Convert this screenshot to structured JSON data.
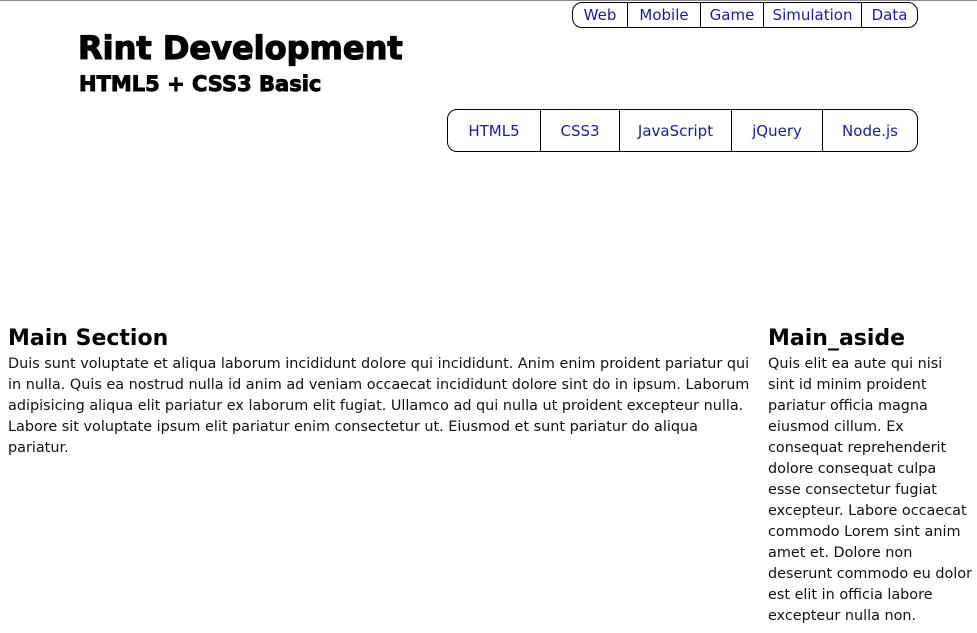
{
  "gnb": {
    "items": [
      {
        "label": "Web"
      },
      {
        "label": "Mobile"
      },
      {
        "label": "Game"
      },
      {
        "label": "Simulation"
      },
      {
        "label": "Data"
      }
    ]
  },
  "header": {
    "title": "Rint Development",
    "subtitle": "HTML5 + CSS3 Basic"
  },
  "lnb": {
    "items": [
      {
        "label": "HTML5"
      },
      {
        "label": "CSS3"
      },
      {
        "label": "JavaScript"
      },
      {
        "label": "jQuery"
      },
      {
        "label": "Node.js"
      }
    ]
  },
  "main_section": {
    "heading": "Main Section",
    "text": "Duis sunt voluptate et aliqua laborum incididunt dolore qui incididunt. Anim enim proident pariatur qui in nulla. Quis ea nostrud nulla id anim ad veniam occaecat incididunt dolore sint do in ipsum. Laborum adipisicing aliqua elit pariatur ex laborum elit fugiat. Ullamco ad qui nulla ut proident excepteur nulla. Labore sit voluptate ipsum elit pariatur enim consectetur ut. Eiusmod et sunt pariatur do aliqua pariatur."
  },
  "main_aside": {
    "heading": "Main_aside",
    "text": "Quis elit ea aute qui nisi sint id minim proident pariatur officia magna eiusmod cillum. Ex consequat reprehenderit dolore consequat culpa esse consectetur fugiat excepteur. Labore occaecat commodo Lorem sint anim amet et. Dolore non deserunt commodo eu dolor est elit in officia labore excepteur nulla non."
  },
  "colors": {
    "link": "#1a1aa6",
    "border": "#000000",
    "text": "#111111"
  }
}
